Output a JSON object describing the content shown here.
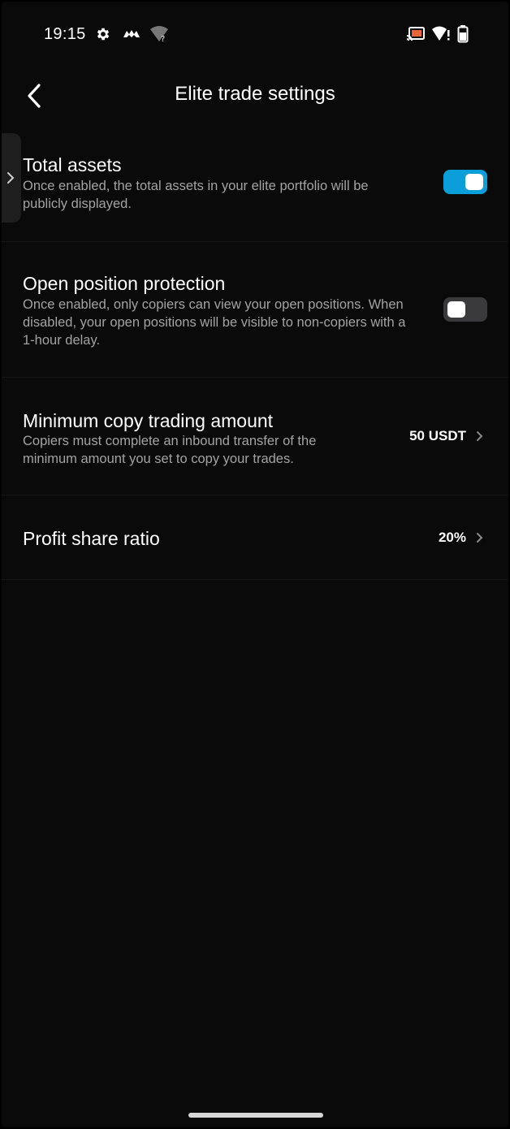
{
  "status_bar": {
    "time": "19:15",
    "left_icons": [
      "gear-icon",
      "game-controller-icon",
      "wifi-question-icon"
    ],
    "right_icons": [
      "cast-icon",
      "wifi-alert-icon",
      "battery-icon"
    ]
  },
  "header": {
    "title": "Elite trade settings",
    "back_icon": "chevron-left-icon"
  },
  "settings": {
    "total_assets": {
      "title": "Total assets",
      "description": "Once enabled, the total assets in your elite portfolio will be publicly displayed.",
      "enabled": true
    },
    "open_position_protection": {
      "title": "Open position protection",
      "description": "Once enabled, only copiers can view your open positions. When disabled, your open positions will be visible to non-copiers with a 1-hour delay.",
      "enabled": false
    },
    "min_copy_amount": {
      "title": "Minimum copy trading amount",
      "description": "Copiers must complete an inbound transfer of the minimum amount you set to copy your trades.",
      "value": "50 USDT"
    },
    "profit_share_ratio": {
      "title": "Profit share ratio",
      "value": "20%"
    }
  },
  "colors": {
    "background": "#0a0a0a",
    "toggle_on": "#0a9fd8",
    "toggle_off": "#3a3a3c",
    "description_text": "#a3a3a3"
  }
}
